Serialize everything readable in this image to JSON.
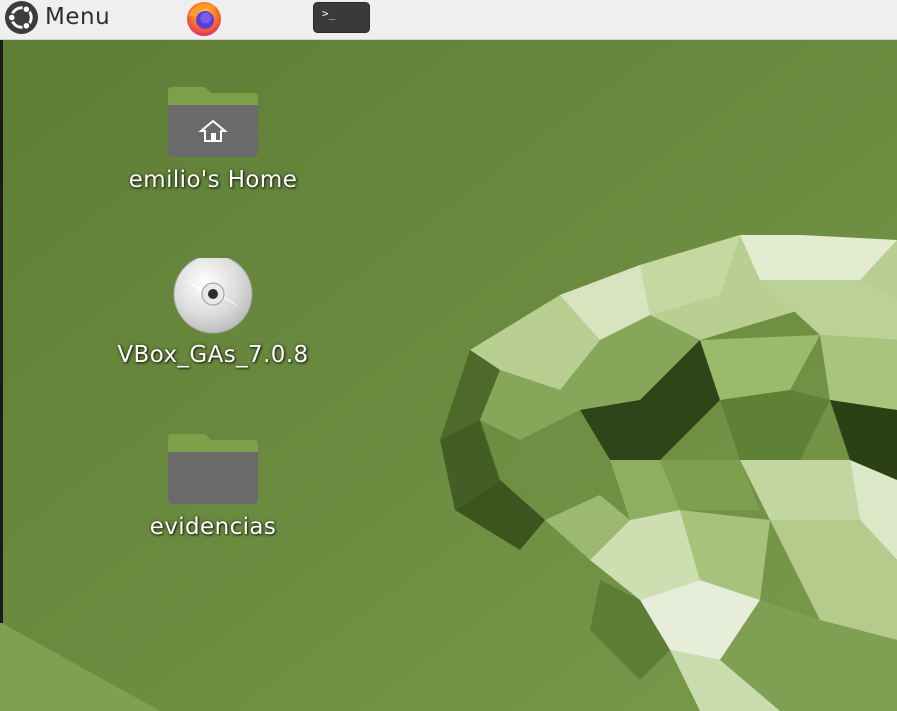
{
  "panel": {
    "menu_label": "Menu",
    "menu_icon": "ubuntu-logo-icon",
    "launchers": [
      {
        "name": "Firefox",
        "icon": "firefox-icon"
      },
      {
        "name": "Terminal",
        "icon": "terminal-icon",
        "glyph": ">_"
      }
    ]
  },
  "desktop": {
    "icons": [
      {
        "label": "emilio's Home",
        "icon": "home-folder-icon"
      },
      {
        "label": "VBox_GAs_7.0.8",
        "icon": "optical-disc-icon"
      },
      {
        "label": "evidencias",
        "icon": "folder-icon"
      }
    ]
  },
  "colors": {
    "panel_bg": "#efefef",
    "wallpaper_base": "#6a8a3e",
    "folder_tab": "#7ba048",
    "folder_body": "#6e6e6e"
  }
}
